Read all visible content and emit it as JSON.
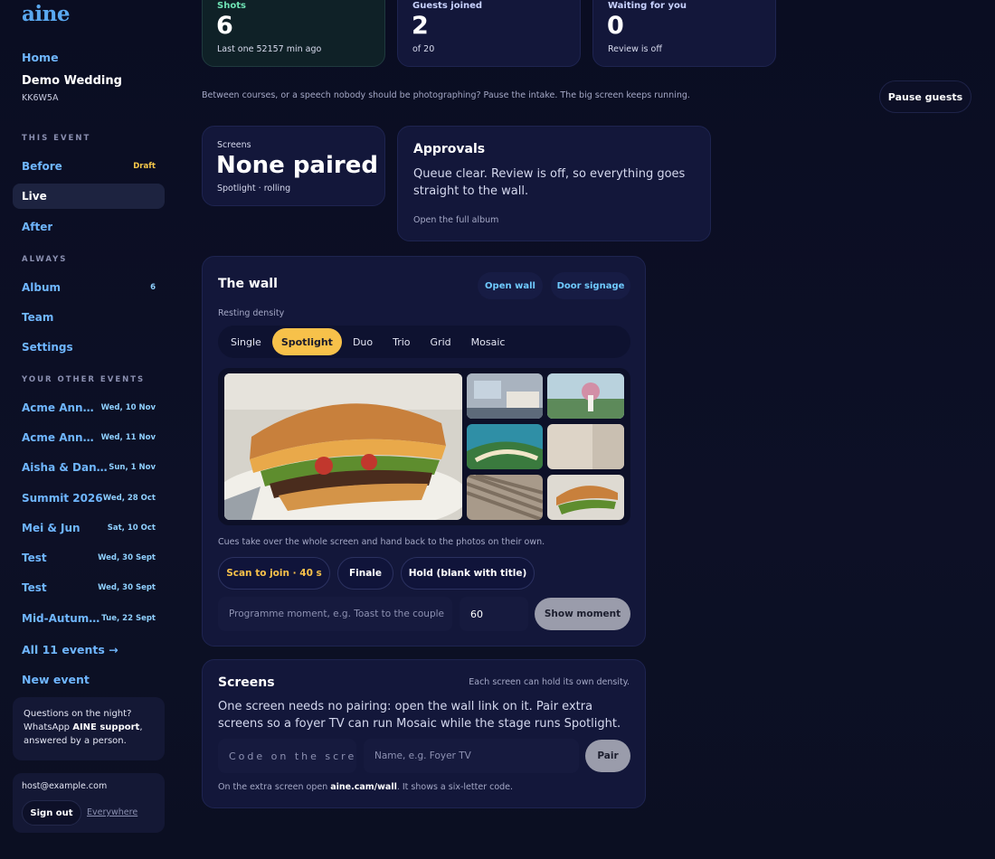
{
  "brand": {
    "logo": "aine"
  },
  "sidebar": {
    "home": "Home",
    "event_name": "Demo Wedding",
    "event_code": "KK6W5A",
    "this_event_label": "THIS EVENT",
    "this_event": [
      {
        "label": "Before",
        "meta": "Draft"
      },
      {
        "label": "Live",
        "meta": ""
      },
      {
        "label": "After",
        "meta": ""
      }
    ],
    "always_label": "ALWAYS",
    "always": [
      {
        "label": "Album",
        "meta": "6"
      },
      {
        "label": "Team",
        "meta": ""
      },
      {
        "label": "Settings",
        "meta": ""
      }
    ],
    "other_label": "YOUR OTHER EVENTS",
    "other_events": [
      {
        "label": "Acme Annual Dinner",
        "date": "Wed, 10 Nov"
      },
      {
        "label": "Acme Annual Dinner",
        "date": "Wed, 11 Nov"
      },
      {
        "label": "Aisha & Daniel",
        "date": "Sun, 1 Nov"
      },
      {
        "label": "Summit 2026",
        "date": "Wed, 28 Oct"
      },
      {
        "label": "Mei & Jun",
        "date": "Sat, 10 Oct"
      },
      {
        "label": "Test",
        "date": "Wed, 30 Sept"
      },
      {
        "label": "Test",
        "date": "Wed, 30 Sept"
      },
      {
        "label": "Mid-Autumn Festival",
        "date": "Tue, 22 Sept"
      }
    ],
    "all_events": "All 11 events →",
    "new_event": "New event",
    "help_line1": "Questions on the night?",
    "help_line2_pre": "WhatsApp ",
    "help_line2_bold": "AINE support",
    "help_line2_post": ",",
    "help_line3": "answered by a person.",
    "account_email": "host@example.com",
    "sign_out": "Sign out",
    "everywhere": "Everywhere"
  },
  "stats": [
    {
      "label": "Shots",
      "value": "6",
      "sub": "Last one 52157 min ago",
      "color": "#6fe3b5"
    },
    {
      "label": "Guests joined",
      "value": "2",
      "sub": "of 20",
      "color": "#c8d2ff"
    },
    {
      "label": "Waiting for you",
      "value": "0",
      "sub": "Review is off",
      "color": "#c8d2ff"
    }
  ],
  "pause": {
    "hint": "Between courses, or a speech nobody should be photographing? Pause the intake. The big screen keeps running.",
    "button": "Pause guests"
  },
  "screens_summary": {
    "label": "Screens",
    "value": "None paired",
    "sub": "Spotlight · rolling"
  },
  "approvals": {
    "title": "Approvals",
    "body": "Queue clear. Review is off, so everything goes straight to the wall.",
    "link": "Open the full album"
  },
  "wall": {
    "title": "The wall",
    "open_wall": "Open wall",
    "door_signage": "Door signage",
    "density_label": "Resting density",
    "densities": [
      "Single",
      "Spotlight",
      "Duo",
      "Trio",
      "Grid",
      "Mosaic"
    ],
    "selected_density": "Spotlight",
    "cues_hint": "Cues take over the whole screen and hand back to the photos on their own.",
    "cue_scan": "Scan to join · 40 s",
    "cue_finale": "Finale",
    "cue_hold": "Hold (blank with title)",
    "moment_placeholder": "Programme moment, e.g. Toast to the couple",
    "moment_seconds": "60",
    "show_moment": "Show moment"
  },
  "screens": {
    "title": "Screens",
    "side_hint": "Each screen can hold its own density.",
    "body": "One screen needs no pairing: open the wall link on it. Pair extra screens so a foyer TV can run Mosaic while the stage runs Spotlight.",
    "code_placeholder": "Code on the scre",
    "name_placeholder": "Name, e.g. Foyer TV",
    "pair": "Pair",
    "footer_pre": "On the extra screen open ",
    "footer_bold": "aine.cam/wall",
    "footer_post": ". It shows a six-letter code."
  }
}
